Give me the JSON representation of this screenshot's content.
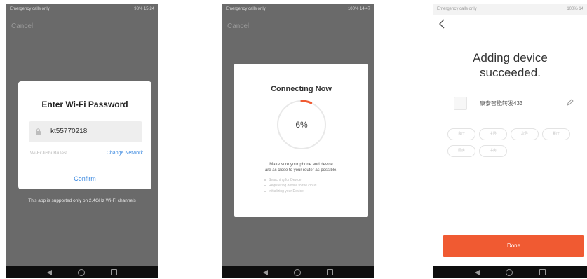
{
  "screen1": {
    "status_left": "Emergency calls only",
    "status_right": "98% 15:24",
    "cancel_label": "Cancel",
    "dialog_title": "Enter Wi-Fi Password",
    "password_value": "kt55770218",
    "ssid": "Wi-Fi:JiShuBuTest",
    "change_network_label": "Change Network",
    "confirm_label": "Confirm",
    "support_note": "This app is supported only on 2.4GHz Wi-Fi channels"
  },
  "screen2": {
    "status_left": "Emergency calls only",
    "status_right": "100% 14:47",
    "cancel_label": "Cancel",
    "dialog_title": "Connecting Now",
    "progress_percent": 6,
    "progress_text": "6%",
    "tip_line1": "Make sure your phone and device",
    "tip_line2": "are as close to your router as possible.",
    "steps": [
      "Searching for Device",
      "Registering device to the cloud",
      "Initializing your Device"
    ]
  },
  "screen3": {
    "status_left": "Emergency calls only",
    "status_right": "100% 14",
    "title_line1": "Adding device",
    "title_line2": "succeeded.",
    "device_name": "康泰智能转发433",
    "room_tags": [
      "客厅",
      "主卧",
      "次卧",
      "餐厅",
      "厨房",
      "书房"
    ],
    "done_label": "Done"
  },
  "colors": {
    "accent_blue": "#3d8ae0",
    "progress_orange": "#f05a32",
    "done_orange": "#f05a32",
    "overlay_gray": "#6a6a6a"
  },
  "icons": {
    "lock": "lock-icon",
    "edit": "pencil-icon",
    "back": "chevron-left-icon",
    "nav_back": "nav-back-icon",
    "nav_home": "nav-home-icon",
    "nav_recent": "nav-recent-icon"
  }
}
